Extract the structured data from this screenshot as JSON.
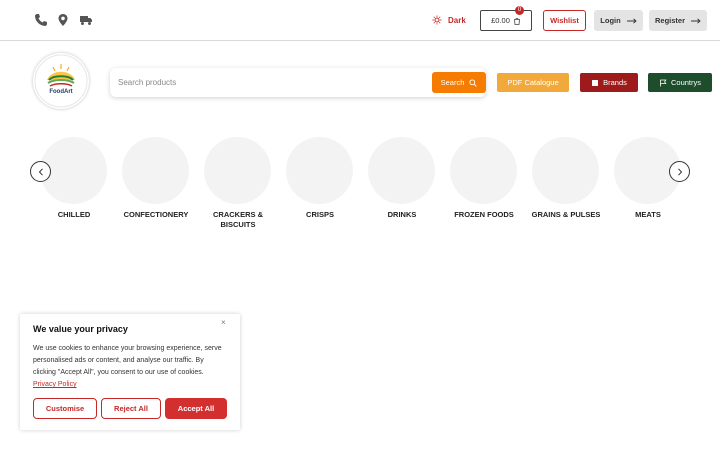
{
  "topbar": {
    "icons": [
      "phone-icon",
      "map-pin-icon",
      "truck-icon"
    ],
    "dark_label": "Dark",
    "cart_total": "£0.00",
    "cart_count": "0",
    "wishlist_label": "Wishlist",
    "login_label": "Login",
    "register_label": "Register"
  },
  "logo": {
    "text": "FoodArt"
  },
  "search": {
    "placeholder": "Search products",
    "button_label": "Search"
  },
  "actions": {
    "catalogue_label": "PDF Catalogue",
    "brands_label": "Brands",
    "countries_label": "Countrys"
  },
  "categories": [
    {
      "label": "CHILLED"
    },
    {
      "label": "CONFECTIONERY"
    },
    {
      "label": "CRACKERS & BISCUITS"
    },
    {
      "label": "CRISPS"
    },
    {
      "label": "DRINKS"
    },
    {
      "label": "FROZEN FOODS"
    },
    {
      "label": "GRAINS & PULSES"
    },
    {
      "label": "MEATS"
    }
  ],
  "cookie": {
    "title": "We value your privacy",
    "close": "×",
    "text": "We use cookies to enhance your browsing experience, serve personalised ads or content, and analyse our traffic. By clicking \"Accept All\", you consent to our use of cookies.",
    "link": "Privacy Policy",
    "customise_label": "Customise",
    "reject_label": "Reject All",
    "accept_label": "Accept All"
  },
  "colors": {
    "brand_red": "#c62828",
    "search_orange": "#f57c00",
    "catalogue_orange": "#f2a93b",
    "brands_red": "#9e1b1b",
    "countries_green": "#1e4d2b"
  }
}
